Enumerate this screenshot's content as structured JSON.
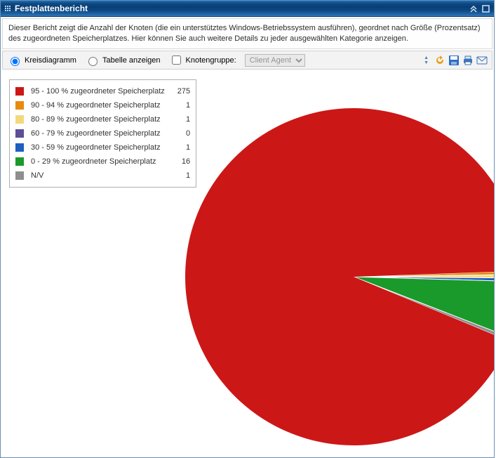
{
  "window": {
    "title": "Festplattenbericht"
  },
  "description": "Dieser Bericht zeigt die Anzahl der Knoten (die ein unterstütztes Windows-Betriebssystem ausführen), geordnet nach Größe (Prozentsatz) des zugeordneten Speicherplatzes. Hier können Sie auch weitere Details zu jeder ausgewählten Kategorie anzeigen.",
  "toolbar": {
    "optPie": "Kreisdiagramm",
    "optTable": "Tabelle anzeigen",
    "chkNodeGroup": "Knotengruppe:",
    "select": {
      "value": "Client Agent"
    }
  },
  "legend": {
    "items": [
      {
        "color": "#cc1717",
        "label": "95 - 100 % zugeordneter Speicherplatz",
        "value": 275
      },
      {
        "color": "#e98a0f",
        "label": "90 - 94 % zugeordneter Speicherplatz",
        "value": 1
      },
      {
        "color": "#f4d97b",
        "label": "80 - 89 % zugeordneter Speicherplatz",
        "value": 1
      },
      {
        "color": "#5d4e97",
        "label": "60 - 79 % zugeordneter Speicherplatz",
        "value": 0
      },
      {
        "color": "#1f5fbf",
        "label": "30 - 59 % zugeordneter Speicherplatz",
        "value": 1
      },
      {
        "color": "#1a9a2a",
        "label": "0 - 29 % zugeordneter Speicherplatz",
        "value": 16
      },
      {
        "color": "#8e8e8e",
        "label": "N/V",
        "value": 1
      }
    ]
  },
  "chart_data": {
    "type": "pie",
    "title": "Festplattenbericht",
    "categories": [
      "95 - 100 % zugeordneter Speicherplatz",
      "90 - 94 % zugeordneter Speicherplatz",
      "80 - 89 % zugeordneter Speicherplatz",
      "60 - 79 % zugeordneter Speicherplatz",
      "30 - 59 % zugeordneter Speicherplatz",
      "0 - 29 % zugeordneter Speicherplatz",
      "N/V"
    ],
    "values": [
      275,
      1,
      1,
      0,
      1,
      16,
      1
    ],
    "colors": [
      "#cc1717",
      "#e98a0f",
      "#f4d97b",
      "#5d4e97",
      "#1f5fbf",
      "#1a9a2a",
      "#8e8e8e"
    ]
  }
}
